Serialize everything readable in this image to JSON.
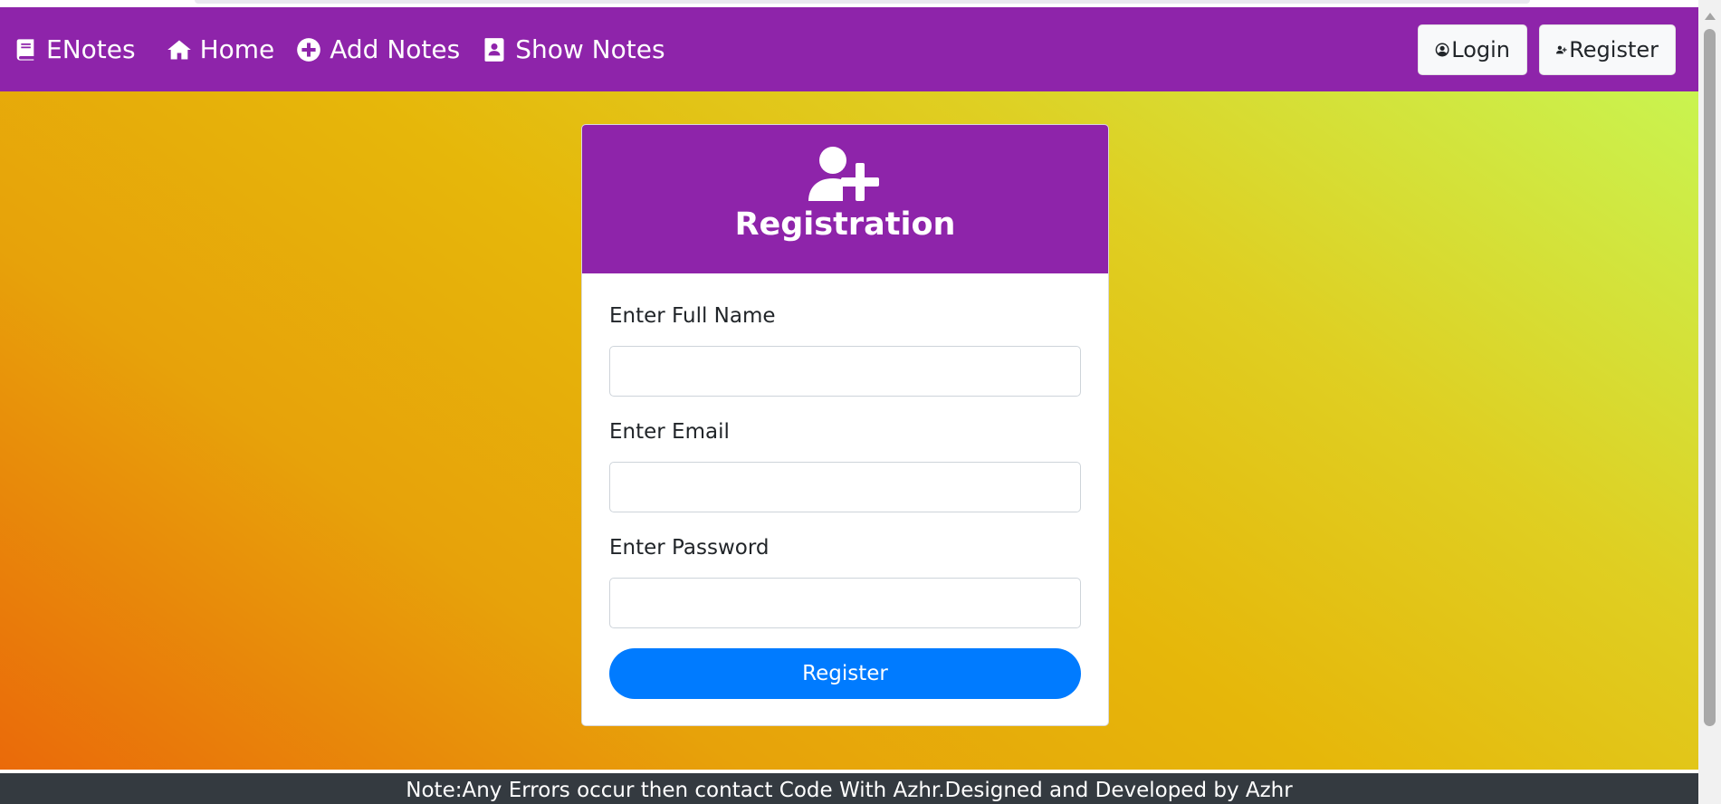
{
  "navbar": {
    "brand": "ENotes",
    "home": "Home",
    "add_notes": "Add Notes",
    "show_notes": "Show Notes",
    "login": "Login",
    "register": "Register"
  },
  "card": {
    "title": "Registration",
    "fields": [
      {
        "label": "Enter Full Name",
        "value": "",
        "placeholder": ""
      },
      {
        "label": "Enter Email",
        "value": "",
        "placeholder": ""
      },
      {
        "label": "Enter Password",
        "value": "",
        "placeholder": ""
      }
    ],
    "submit_label": "Register"
  },
  "footer": {
    "text": "Note:Any Errors occur then contact Code With Azhr.Designed and Developed by Azhr"
  },
  "colors": {
    "nav_bg": "#8e24aa",
    "button_primary": "#007bff",
    "footer_bg": "#343a40"
  },
  "icons": {
    "brand": "book-icon",
    "home": "home-icon",
    "add_notes": "plus-circle-icon",
    "show_notes": "address-book-icon",
    "login": "user-circle-icon",
    "register": "user-plus-icon",
    "card_header": "user-plus-icon"
  }
}
